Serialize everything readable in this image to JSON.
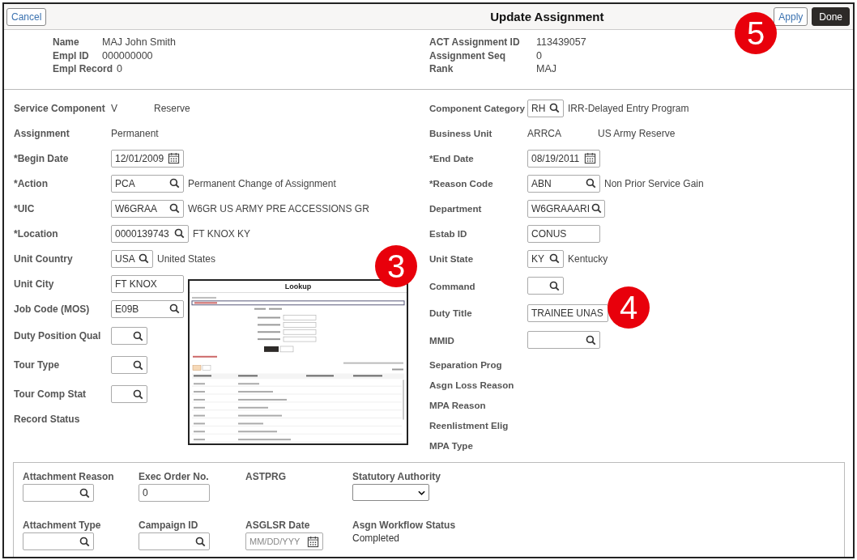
{
  "header": {
    "cancel": "Cancel",
    "title": "Update Assignment",
    "buttons": [
      {
        "label": "Apply",
        "kind": "secondary"
      },
      {
        "label": "Done",
        "kind": "primary"
      }
    ]
  },
  "summary": {
    "left": [
      {
        "label": "Name",
        "value": "MAJ John Smith"
      },
      {
        "label": "Empl ID",
        "value": "000000000"
      },
      {
        "label": "Empl Record",
        "value": "0"
      }
    ],
    "right": [
      {
        "label": "ACT Assignment ID",
        "value": "113439057"
      },
      {
        "label": "Assignment Seq",
        "value": "0"
      },
      {
        "label": "Rank",
        "value": "MAJ"
      }
    ]
  },
  "form": {
    "left": [
      {
        "label": "Service Component",
        "kind": "display",
        "value": "V",
        "description": "Reserve"
      },
      {
        "label": "Assignment",
        "kind": "display",
        "value": "Permanent"
      },
      {
        "label": "*Begin Date",
        "kind": "date",
        "value": "12/01/2009"
      },
      {
        "label": "*Action",
        "kind": "lookup",
        "value": "PCA",
        "description": "Permanent Change of Assignment"
      },
      {
        "label": "*UIC",
        "kind": "lookup",
        "value": "W6GRAA",
        "description": "W6GR US ARMY PRE ACCESSIONS GR"
      },
      {
        "label": "*Location",
        "kind": "lookup",
        "value": "0000139743",
        "description": "FT KNOX KY"
      },
      {
        "label": "Unit Country",
        "kind": "lookup",
        "value": "USA",
        "description": "United States"
      },
      {
        "label": "Unit City",
        "kind": "text",
        "value": "FT KNOX"
      },
      {
        "label": "Job Code (MOS)",
        "kind": "lookup",
        "value": "E09B"
      },
      {
        "label": "Duty Position Qual",
        "kind": "lookup"
      },
      {
        "label": "Tour Type",
        "kind": "lookup"
      },
      {
        "label": "Tour Comp Stat",
        "kind": "lookup"
      },
      {
        "label": "Record Status",
        "kind": "label"
      }
    ],
    "right": [
      {
        "label": "Component Category",
        "kind": "lookup",
        "value": "RH",
        "description": "IRR-Delayed Entry Program"
      },
      {
        "label": "Business Unit",
        "kind": "display",
        "value": "ARRCA",
        "description": "US Army Reserve"
      },
      {
        "label": "*End Date",
        "kind": "date",
        "value": "08/19/2011"
      },
      {
        "label": "*Reason Code",
        "kind": "lookup",
        "value": "ABN",
        "description": "Non Prior Service Gain"
      },
      {
        "label": "Department",
        "kind": "lookup",
        "value": "W6GRAAARI"
      },
      {
        "label": "Estab ID",
        "kind": "text",
        "value": "CONUS"
      },
      {
        "label": "Unit State",
        "kind": "lookup",
        "value": "KY",
        "description": "Kentucky"
      },
      {
        "label": "Command",
        "kind": "lookup"
      },
      {
        "label": "Duty Title",
        "kind": "text",
        "value": "TRAINEE UNAS"
      },
      {
        "label": "MMID",
        "kind": "lookup"
      },
      {
        "label": "Separation Prog",
        "kind": "label"
      },
      {
        "label": "Asgn Loss Reason",
        "kind": "label"
      },
      {
        "label": "MPA Reason",
        "kind": "label"
      },
      {
        "label": "Reenlistment Elig",
        "kind": "label"
      },
      {
        "label": "MPA Type",
        "kind": "label"
      }
    ]
  },
  "details": [
    {
      "label": "Attachment Reason",
      "kind": "lookup"
    },
    {
      "label": "Exec Order No.",
      "kind": "text",
      "value": "0"
    },
    {
      "label": "ASTPRG",
      "kind": "label"
    },
    {
      "label": "Statutory Authority",
      "kind": "select"
    },
    {
      "label": "Attachment Type",
      "kind": "lookup"
    },
    {
      "label": "Campaign ID",
      "kind": "lookup"
    },
    {
      "label": "ASGLSR Date",
      "kind": "date",
      "placeholder": "MM/DD/YYY"
    },
    {
      "label": "Asgn Workflow Status",
      "kind": "display",
      "value": "Completed"
    }
  ],
  "lookup_preview": {
    "title": "Lookup"
  },
  "annotations": [
    {
      "label": "3"
    },
    {
      "label": "4"
    },
    {
      "label": "5"
    }
  ]
}
